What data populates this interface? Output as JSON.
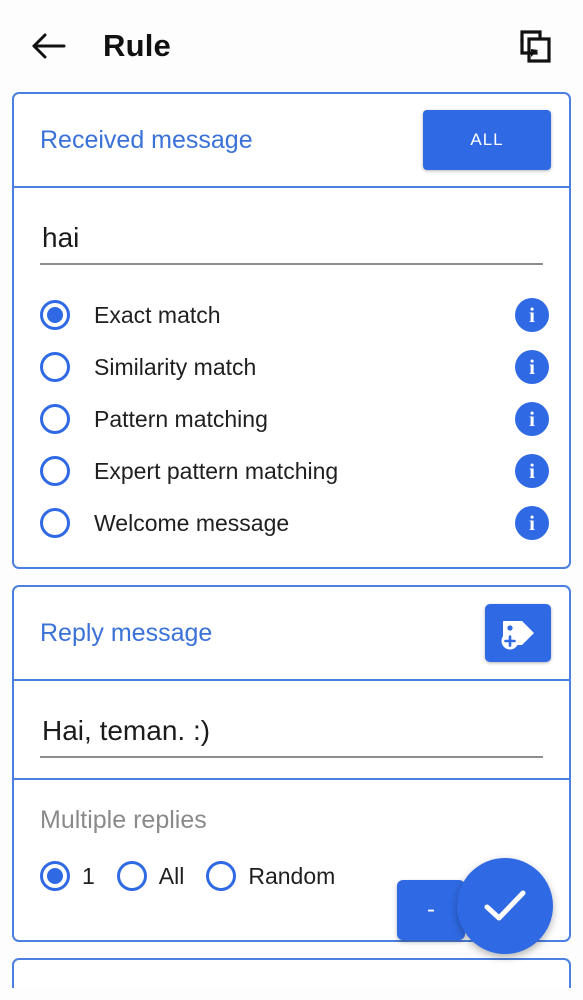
{
  "appbar": {
    "back_icon": "arrow-left-icon",
    "title": "Rule",
    "action_icon": "move-to-icon"
  },
  "theme": {
    "accent": "#2f6ae4",
    "card_border": "#4b7fe0",
    "title_blue": "#3a72d8",
    "muted_text": "#8a8a8a",
    "background": "#fdfdfd"
  },
  "received_message": {
    "title": "Received message",
    "all_button": "ALL",
    "input_value": "hai",
    "input_placeholder": "Received message",
    "match_options": [
      {
        "label": "Exact match",
        "selected": true,
        "info": "i"
      },
      {
        "label": "Similarity match",
        "selected": false,
        "info": "i"
      },
      {
        "label": "Pattern matching",
        "selected": false,
        "info": "i"
      },
      {
        "label": "Expert pattern matching",
        "selected": false,
        "info": "i"
      },
      {
        "label": "Welcome message",
        "selected": false,
        "info": "i"
      }
    ]
  },
  "reply_message": {
    "title": "Reply message",
    "tag_button_icon": "add-tag-icon",
    "input_value": "Hai, teman. :)",
    "input_placeholder": "Reply message",
    "multiple_replies": {
      "label": "Multiple replies",
      "options": [
        {
          "label": "1",
          "selected": true
        },
        {
          "label": "All",
          "selected": false
        },
        {
          "label": "Random",
          "selected": false
        }
      ]
    },
    "minus_button": "-",
    "confirm_icon": "check-icon"
  }
}
